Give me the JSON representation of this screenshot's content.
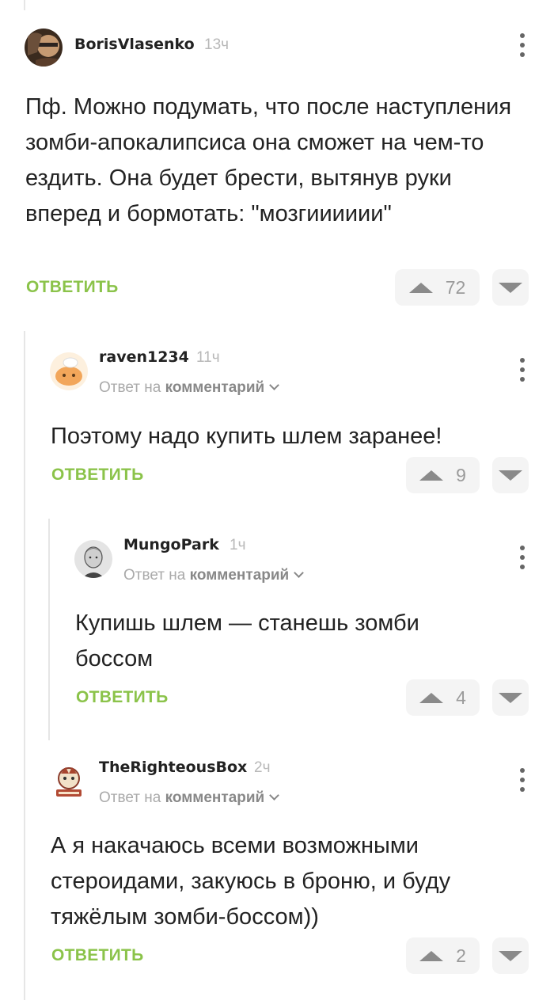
{
  "comments": [
    {
      "author": "BorisVlasenko",
      "time": "13ч",
      "text": "Пф. Можно подумать, что после наступления зомби-апокалипсиса она сможет на чем-то ездить. Она будет брести, вытянув руки вперед и бормотать: \"мозгииииии\"",
      "reply_label": "ОТВЕТИТЬ",
      "votes": "72"
    },
    {
      "author": "raven1234",
      "time": "11ч",
      "reply_prefix": "Ответ на",
      "reply_target": "комментарий",
      "text": "Поэтому надо купить шлем заранее!",
      "reply_label": "ОТВЕТИТЬ",
      "votes": "9"
    },
    {
      "author": "MungoPark",
      "time": "1ч",
      "reply_prefix": "Ответ на",
      "reply_target": "комментарий",
      "text": "Купишь шлем — станешь зомби боссом",
      "reply_label": "ОТВЕТИТЬ",
      "votes": "4"
    },
    {
      "author": "TheRighteousBox",
      "time": "2ч",
      "reply_prefix": "Ответ на",
      "reply_target": "комментарий",
      "text": "А я накачаюсь всеми возможными стероидами, закуюсь в броню, и буду тяжёлым зомби-боссом))",
      "reply_label": "ОТВЕТИТЬ",
      "votes": "2"
    }
  ],
  "colors": {
    "accent": "#8bc34a",
    "vote_bg": "#f4f4f4",
    "thread_line": "#e6e6e6"
  },
  "icons": [
    "avatar",
    "kebab-menu-icon",
    "chevron-down-icon",
    "upvote-icon",
    "downvote-icon"
  ]
}
